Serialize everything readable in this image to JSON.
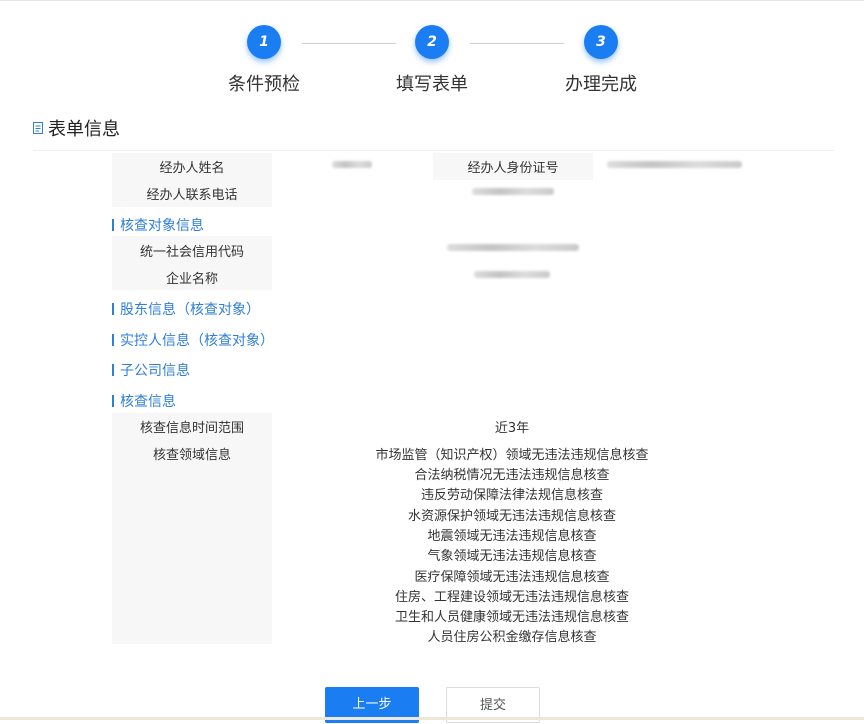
{
  "steps": [
    {
      "number": "1",
      "label": "条件预检"
    },
    {
      "number": "2",
      "label": "填写表单"
    },
    {
      "number": "3",
      "label": "办理完成"
    }
  ],
  "section": {
    "title": "表单信息"
  },
  "agent": {
    "name_label": "经办人姓名",
    "id_label": "经办人身份证号",
    "phone_label": "经办人联系电话"
  },
  "subsections": {
    "target": "核查对象信息",
    "shareholder": "股东信息（核查对象）",
    "controller": "实控人信息（核查对象）",
    "subsidiary": "子公司信息",
    "verify": "核查信息"
  },
  "target_fields": {
    "credit_code_label": "统一社会信用代码",
    "company_label": "企业名称"
  },
  "verify_fields": {
    "time_range_label": "核查信息时间范围",
    "time_range_value": "近3年",
    "domain_label": "核查领域信息",
    "domains": [
      "市场监管（知识产权）领域无违法违规信息核查",
      "合法纳税情况无违法违规信息核查",
      "违反劳动保障法律法规信息核查",
      "水资源保护领域无违法违规信息核查",
      "地震领域无违法违规信息核查",
      "气象领域无违法违规信息核查",
      "医疗保障领域无违法违规信息核查",
      "住房、工程建设领域无违法违规信息核查",
      "卫生和人员健康领域无违法违规信息核查",
      "人员住房公积金缴存信息核查"
    ]
  },
  "buttons": {
    "prev": "上一步",
    "submit": "提交"
  },
  "colors": {
    "accent": "#1a7df1",
    "link": "#2f7fd8"
  }
}
